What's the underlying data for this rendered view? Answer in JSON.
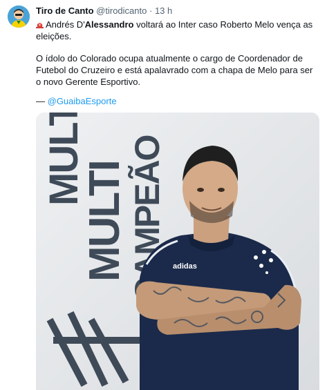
{
  "tweet": {
    "author_name": "Tiro de Canto",
    "handle": "@tirodicanto",
    "separator": "·",
    "time": "13 h",
    "line1_prefix": "Andrés D'",
    "line1_bold": "Alessandro",
    "line1_suffix": " voltará ao Inter caso Roberto Melo vença as eleições.",
    "paragraph2": "O ídolo do Colorado ocupa atualmente o cargo de Coordenador de Futebol do Cruzeiro e está apalavrado com a chapa de Melo para ser o novo Gerente Esportivo.",
    "source_dash": "— ",
    "source_link": "@GuaibaEsporte"
  },
  "photo": {
    "wall_text": [
      "MULTI",
      "MULTI",
      "CAMPEÃO"
    ],
    "shirt_brand": "adidas"
  },
  "icons": {
    "alert": "siren-icon",
    "avatar": "avatar-illustration"
  },
  "colors": {
    "link": "#1d9bf0",
    "secondary_text": "#536471",
    "jersey": "#1b2a4a"
  }
}
